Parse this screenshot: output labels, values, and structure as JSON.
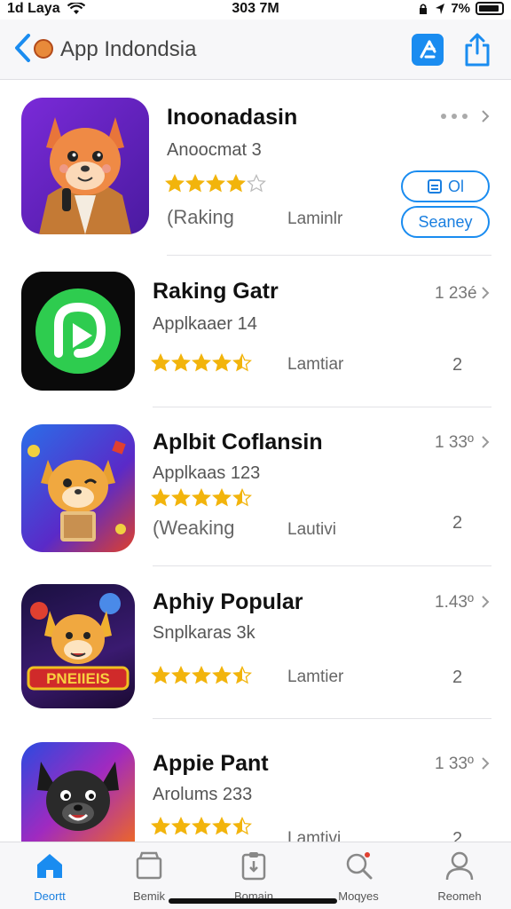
{
  "status_bar": {
    "carrier": "1d Laya",
    "time": "303 7M",
    "battery_text": "7%"
  },
  "nav": {
    "title": "App Indondsia"
  },
  "apps": [
    {
      "name": "Inoonadasin",
      "subtitle": "Anoocmat 3",
      "rating": 4,
      "rank_label": "(Raking",
      "meta_label": "Laminlr",
      "right_value": "",
      "right_count": "",
      "button_primary": "Ol",
      "button_secondary": "Seaney"
    },
    {
      "name": "Raking Gatr",
      "subtitle": "Applkaaer 14",
      "rating": 4.5,
      "rank_label": "",
      "meta_label": "Lamtiar",
      "right_value": "1 23é",
      "right_count": "2"
    },
    {
      "name": "Aplbit Coflansin",
      "subtitle": "Applkaas 123",
      "rating": 4.5,
      "rank_label": "(Weaking",
      "meta_label": "Lautivi",
      "right_value": "1 33º",
      "right_count": "2"
    },
    {
      "name": "Aphiy Popular",
      "subtitle": "Snplkaras 3k",
      "rating": 4.5,
      "rank_label": "",
      "meta_label": "Lamtier",
      "right_value": "1.43º",
      "right_count": "2"
    },
    {
      "name": "Appie Pant",
      "subtitle": "Arolums 233",
      "rating": 4.5,
      "rank_label": "",
      "meta_label": "Lamtivi",
      "right_value": "1 33º",
      "right_count": "2"
    }
  ],
  "app_icon_text": {
    "game_banner": "PNEIIEIS"
  },
  "tabs": [
    {
      "label": "Deortt",
      "icon": "home-icon",
      "active": true
    },
    {
      "label": "Bemik",
      "icon": "store-icon",
      "active": false
    },
    {
      "label": "Bomain",
      "icon": "clipboard-icon",
      "active": false
    },
    {
      "label": "Moqyes",
      "icon": "search-icon",
      "active": false
    },
    {
      "label": "Reomeh",
      "icon": "person-icon",
      "active": false
    }
  ],
  "colors": {
    "accent": "#1a8cf0",
    "star": "#f2b40c"
  }
}
